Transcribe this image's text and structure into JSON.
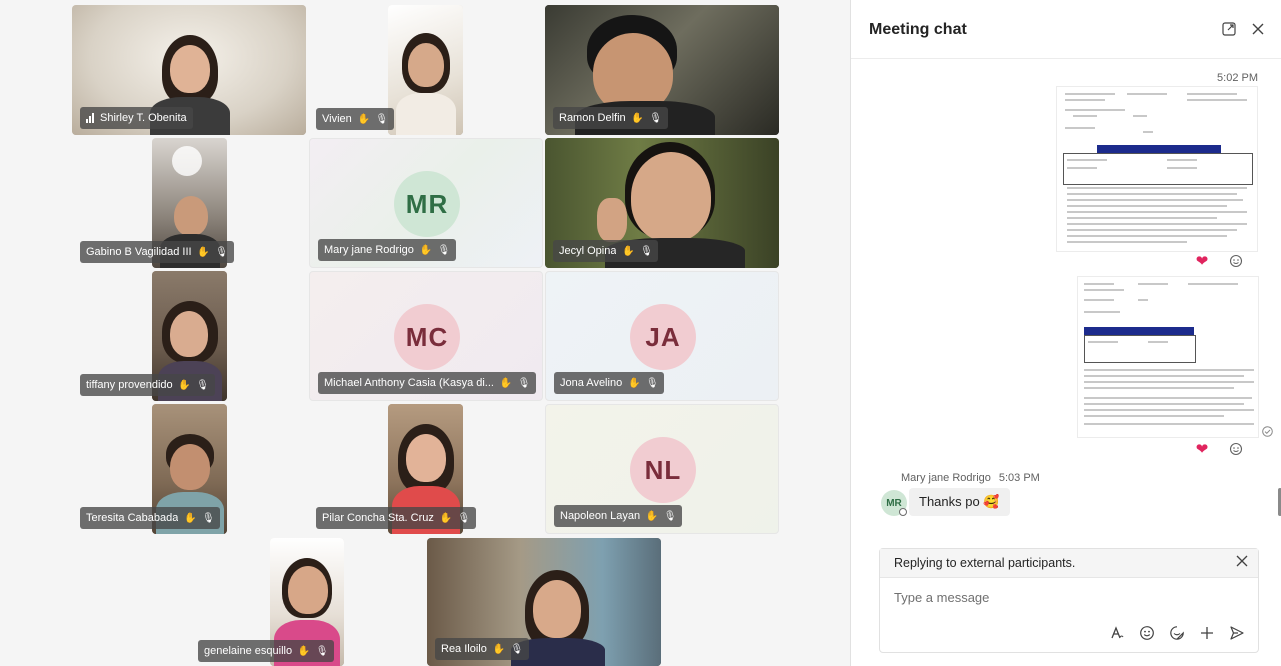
{
  "participants": {
    "shirley": "Shirley T. Obenita",
    "vivien": "Vivien",
    "ramon": "Ramon Delfin",
    "gabino": "Gabino B Vagilidad III",
    "maryjane": "Mary jane Rodrigo",
    "jecyl": "Jecyl Opina",
    "tiffany": "tiffany provendido",
    "michael": "Michael Anthony Casia (Kasya di...",
    "jona": "Jona Avelino",
    "teresita": "Teresita Cababada",
    "pilar": "Pilar Concha Sta. Cruz",
    "napoleon": "Napoleon Layan",
    "genelaine": "genelaine esquillo",
    "rea": "Rea Iloilo"
  },
  "initials": {
    "maryjane": "MR",
    "michael": "MC",
    "jona": "JA",
    "napoleon": "NL"
  },
  "chat": {
    "title": "Meeting chat",
    "time_first": "5:02 PM",
    "sender_name": "Mary jane Rodrigo",
    "sender_time": "5:03 PM",
    "sender_initials": "MR",
    "message": "Thanks po",
    "message_emoji": "🥰",
    "reply_banner": "Replying to external participants.",
    "placeholder": "Type a message"
  },
  "icons": {
    "mic_off": "mic-off-icon",
    "raised_hand": "raised-hand-icon",
    "popout": "popout-icon",
    "close": "close-icon",
    "heart": "heart-reaction-icon",
    "add_reaction": "add-reaction-icon",
    "format": "format-icon",
    "emoji": "emoji-icon",
    "sticker": "sticker-icon",
    "attach": "plus-icon",
    "send": "send-icon"
  },
  "colors": {
    "accent_blue": "#1c2b8c",
    "heart": "#e0245e"
  }
}
